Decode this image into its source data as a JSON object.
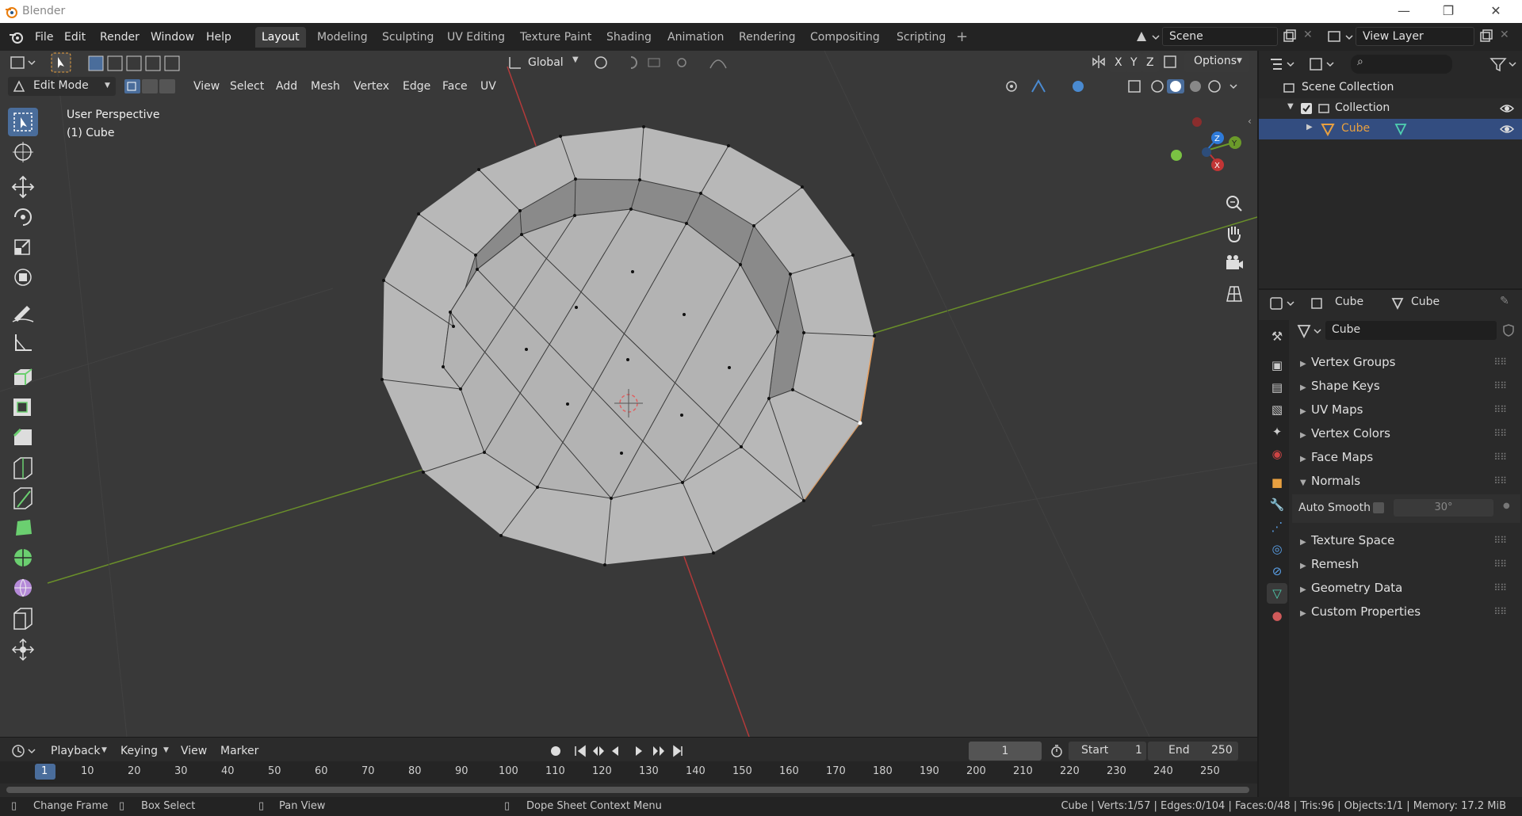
{
  "window": {
    "title": "Blender",
    "min": "—",
    "max": "❐",
    "close": "✕"
  },
  "menu": [
    "File",
    "Edit",
    "Render",
    "Window",
    "Help"
  ],
  "workspaces": [
    {
      "label": "Layout",
      "active": true
    },
    {
      "label": "Modeling"
    },
    {
      "label": "Sculpting"
    },
    {
      "label": "UV Editing"
    },
    {
      "label": "Texture Paint"
    },
    {
      "label": "Shading"
    },
    {
      "label": "Animation"
    },
    {
      "label": "Rendering"
    },
    {
      "label": "Compositing"
    },
    {
      "label": "Scripting"
    }
  ],
  "add_workspace": "+",
  "scene": {
    "label": "Scene",
    "view_layer": "View Layer"
  },
  "viewport": {
    "transform_orientation": "Global",
    "options": "Options",
    "axes": [
      "X",
      "Y",
      "Z"
    ],
    "mode": "Edit Mode",
    "menus": [
      "View",
      "Select",
      "Add",
      "Mesh",
      "Vertex",
      "Edge",
      "Face",
      "UV"
    ],
    "overlay_title": "User Perspective",
    "overlay_object": "(1) Cube",
    "gizmo": {
      "x": "X",
      "y": "Y",
      "z": "Z"
    }
  },
  "outliner": {
    "search_placeholder": "",
    "scene_collection": "Scene Collection",
    "collection": "Collection",
    "object": "Cube"
  },
  "properties": {
    "context_object": "Cube",
    "context_data": "Cube",
    "datablock": "Cube",
    "panels": [
      {
        "label": "Vertex Groups",
        "open": false
      },
      {
        "label": "Shape Keys",
        "open": false
      },
      {
        "label": "UV Maps",
        "open": false
      },
      {
        "label": "Vertex Colors",
        "open": false
      },
      {
        "label": "Face Maps",
        "open": false
      },
      {
        "label": "Normals",
        "open": true
      },
      {
        "label": "Texture Space",
        "open": false
      },
      {
        "label": "Remesh",
        "open": false
      },
      {
        "label": "Geometry Data",
        "open": false
      },
      {
        "label": "Custom Properties",
        "open": false
      }
    ],
    "auto_smooth_label": "Auto Smooth",
    "auto_smooth_angle": "30°"
  },
  "timeline": {
    "menus": [
      "Playback",
      "Keying",
      "View",
      "Marker"
    ],
    "current_frame": "1",
    "start_label": "Start",
    "start": "1",
    "end_label": "End",
    "end": "250",
    "ruler": [
      "1",
      "10",
      "20",
      "30",
      "40",
      "50",
      "60",
      "70",
      "80",
      "90",
      "100",
      "110",
      "120",
      "130",
      "140",
      "150",
      "160",
      "170",
      "180",
      "190",
      "200",
      "210",
      "220",
      "230",
      "240",
      "250"
    ]
  },
  "status": {
    "change_frame": "Change Frame",
    "box_select": "Box Select",
    "pan_view": "Pan View",
    "context_menu": "Dope Sheet Context Menu",
    "stats": "Cube | Verts:1/57 | Edges:0/104 | Faces:0/48 | Tris:96 | Objects:1/1 | Memory: 17.2 MiB"
  },
  "colors": {
    "accent": "#4a6d9b",
    "selected_row": "#334d80",
    "x_axis": "#c23535",
    "y_axis": "#6b9a2a",
    "z_axis": "#2e7ad8"
  }
}
